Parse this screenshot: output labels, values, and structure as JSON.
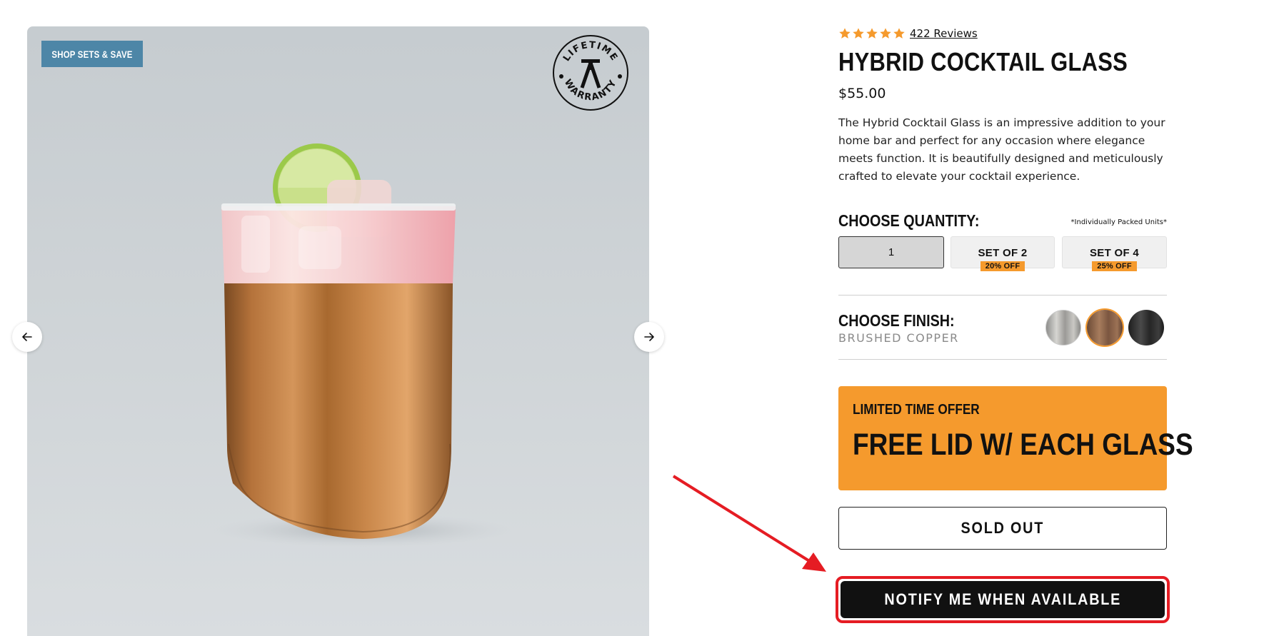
{
  "gallery": {
    "promo_badge": "SHOP SETS & SAVE",
    "warranty_seal": "LIFETIME WARRANTY",
    "prev_icon": "arrow-left-icon",
    "next_icon": "arrow-right-icon"
  },
  "product": {
    "rating": 5,
    "reviews": "422 Reviews",
    "title": "HYBRID COCKTAIL GLASS",
    "price": "$55.00",
    "description": "The Hybrid Cocktail Glass is an impressive addition to your home bar and perfect for any occasion where elegance meets function. It is beautifully designed and meticulously crafted to elevate your cocktail experience."
  },
  "quantity": {
    "label": "CHOOSE QUANTITY:",
    "note": "*Individually Packed Units*",
    "options": [
      {
        "label": "1",
        "discount": ""
      },
      {
        "label": "SET OF 2",
        "discount": "20% OFF"
      },
      {
        "label": "SET OF 4",
        "discount": "25% OFF"
      }
    ],
    "selected": "1"
  },
  "finish": {
    "label": "CHOOSE FINISH:",
    "value": "BRUSHED COPPER",
    "swatches": [
      "steel",
      "copper",
      "black"
    ],
    "selected": "copper"
  },
  "offer": {
    "kicker": "LIMITED TIME OFFER",
    "headline": "FREE LID W/ EACH GLASS"
  },
  "buttons": {
    "sold_out": "SOLD OUT",
    "notify": "NOTIFY ME WHEN AVAILABLE"
  },
  "colors": {
    "accent_orange": "#f59a2d",
    "badge_blue": "#4d86a7",
    "highlight_red": "#e51c23"
  }
}
